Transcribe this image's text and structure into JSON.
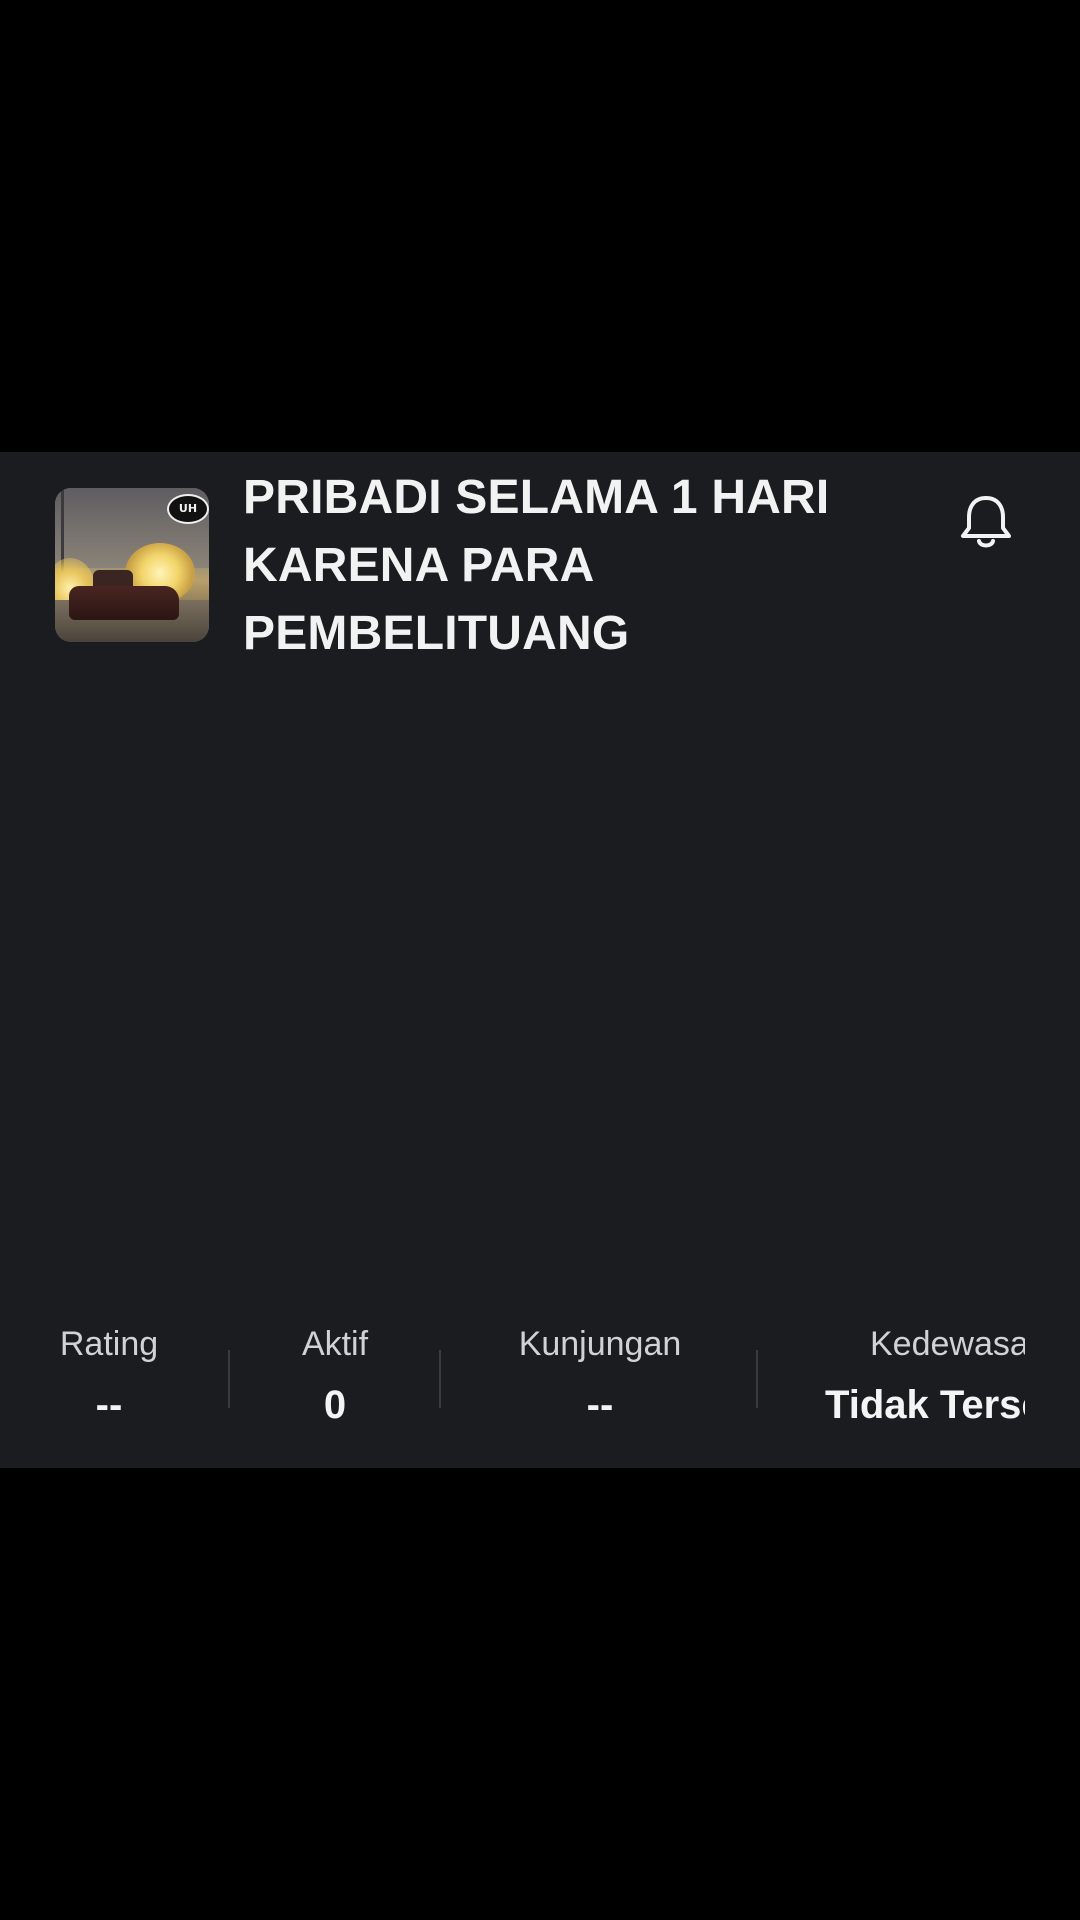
{
  "game": {
    "title": "PRIBADI SELAMA 1 HARI KARENA PARA PEMBELITUANG",
    "thumbnail_logo": "UH"
  },
  "icons": {
    "notification": "bell-icon"
  },
  "stats": [
    {
      "label": "Rating",
      "value": "--"
    },
    {
      "label": "Aktif",
      "value": "0"
    },
    {
      "label": "Kunjungan",
      "value": "--"
    },
    {
      "label": "Kedewasaan",
      "value": "Tidak Tersedia"
    }
  ],
  "colors": {
    "panel_bg": "#1b1c20",
    "letterbox": "#000000",
    "text_primary": "#f2f2f2",
    "text_secondary": "#d2d2d4",
    "divider": "#3a3b40"
  }
}
